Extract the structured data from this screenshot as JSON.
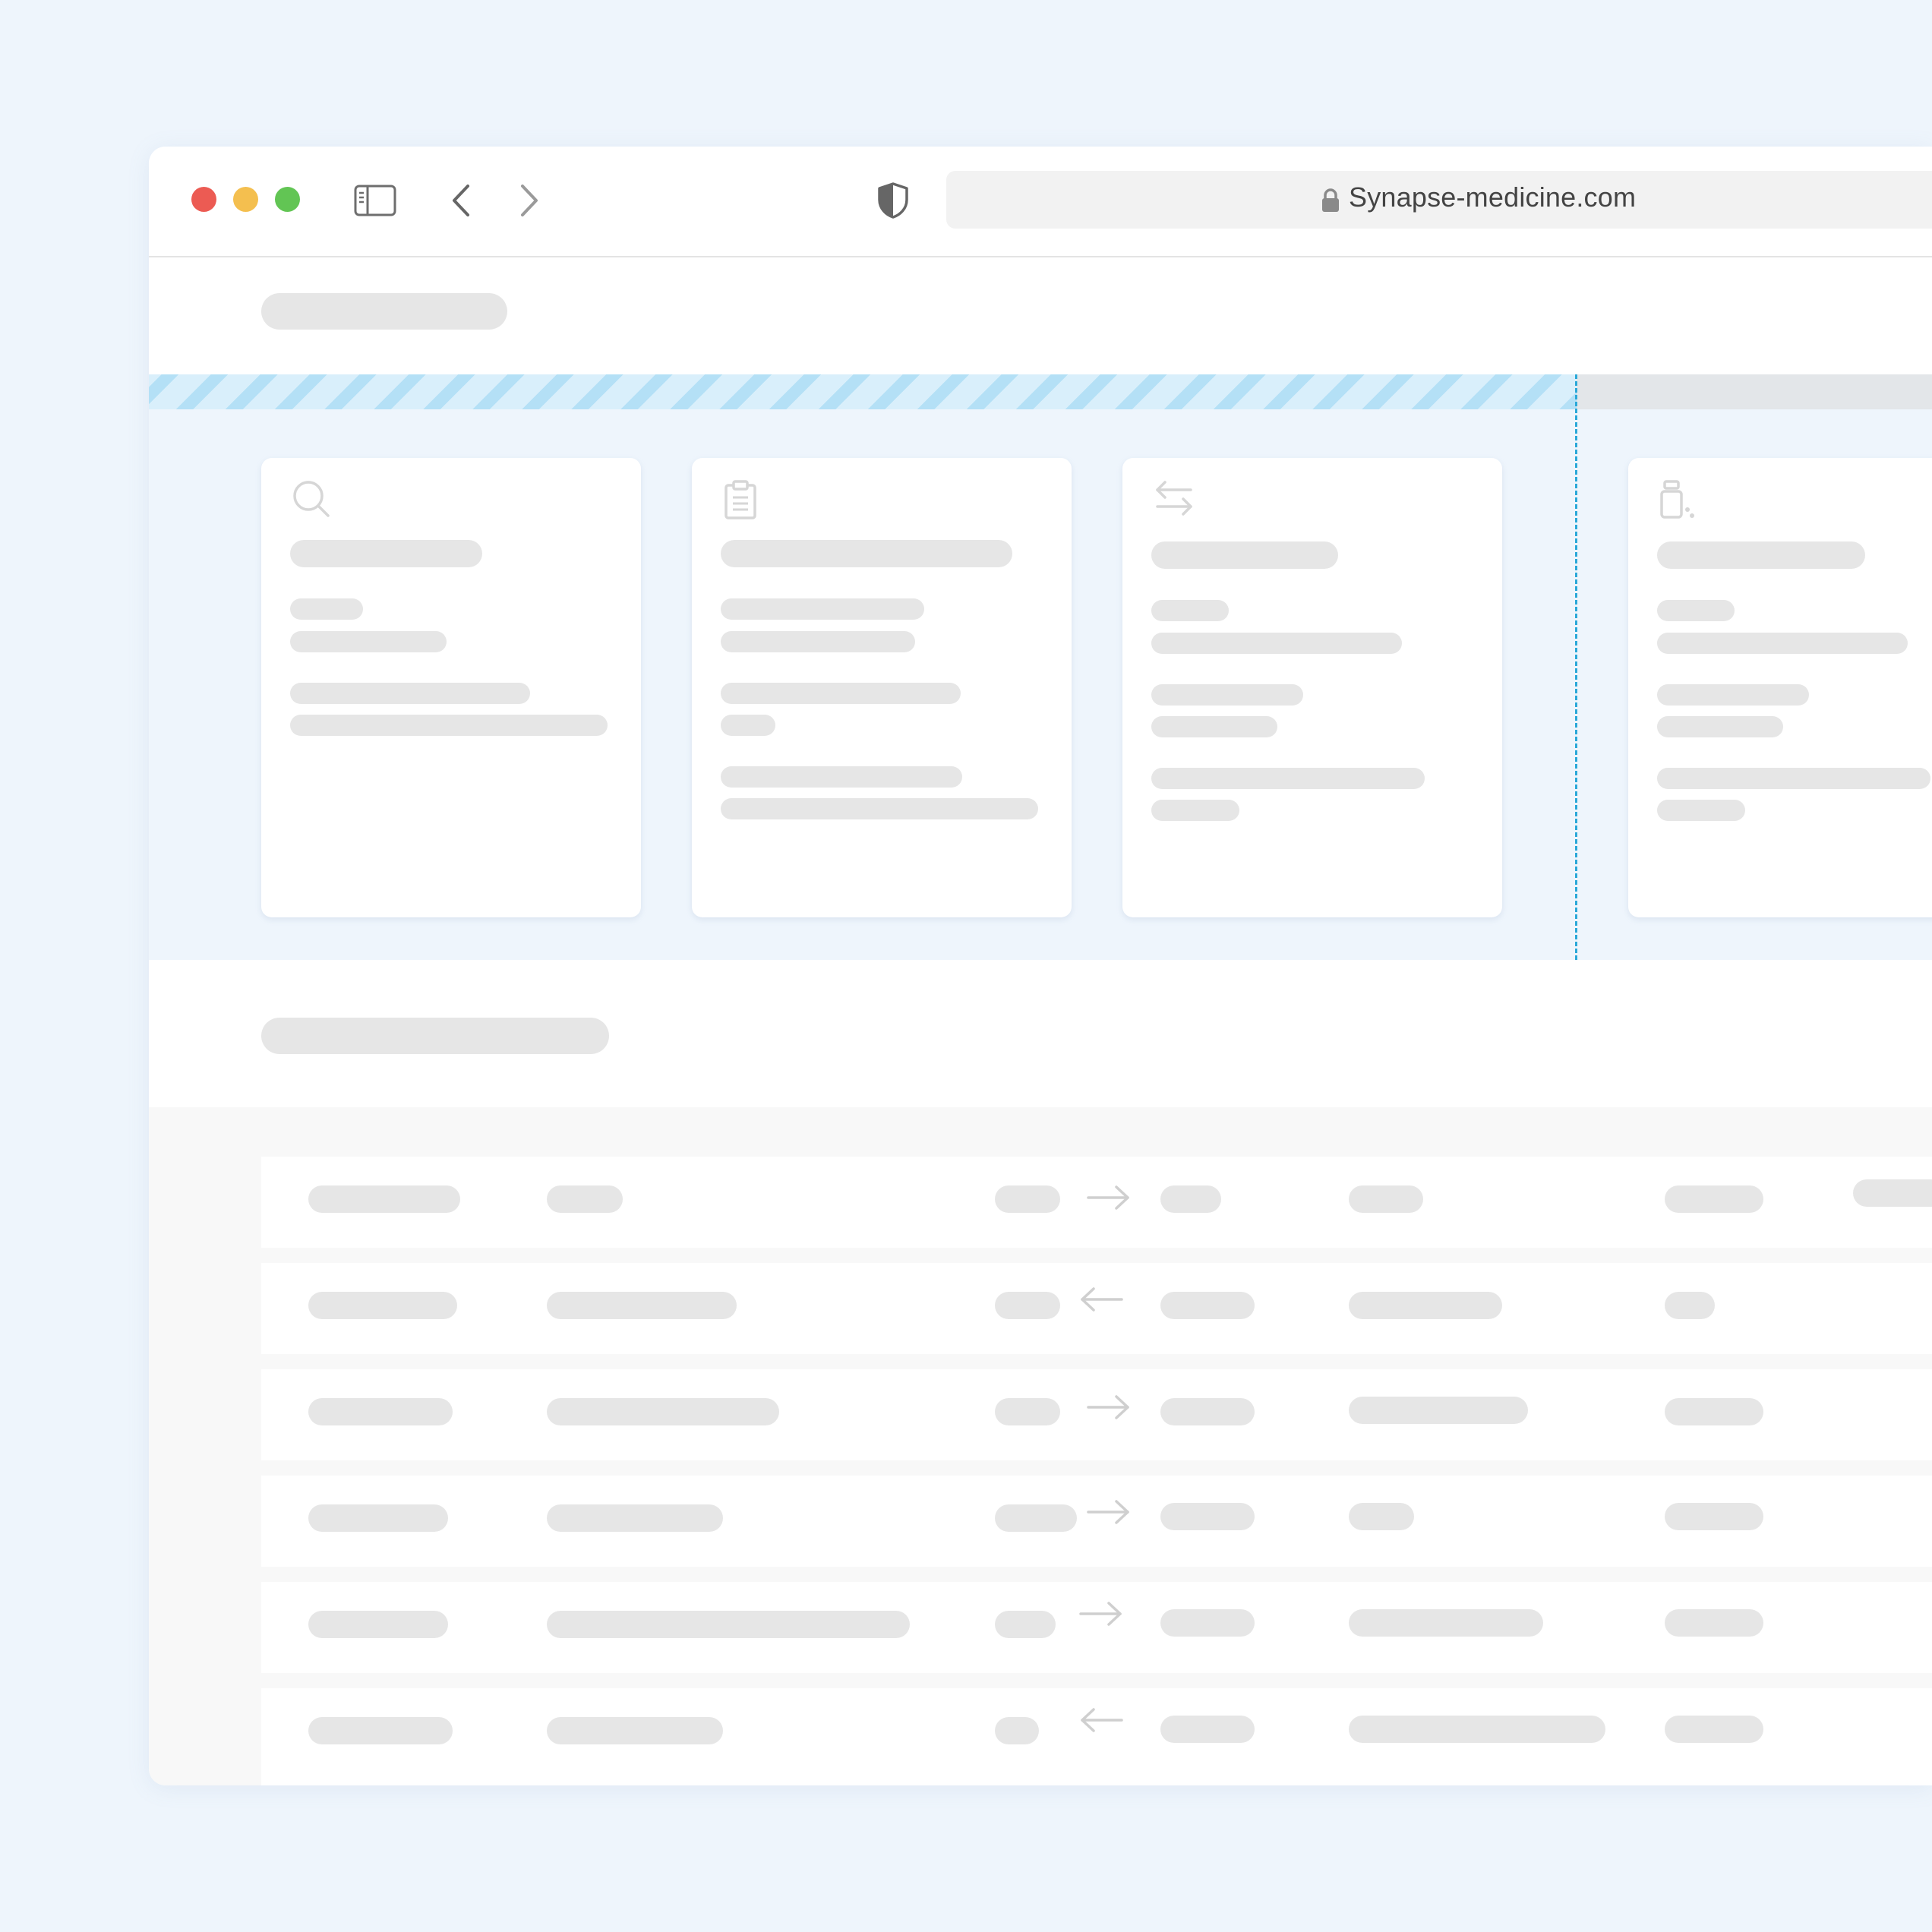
{
  "browser": {
    "url": "Synapse-medicine.com"
  },
  "colors": {
    "page_bg": "#eef5fc",
    "close": "#ec5b53",
    "minimize": "#f4bf4f",
    "maximize": "#62c554",
    "skeleton": "#e6e6e6",
    "progress_stripe": "#b4e0f6",
    "progress_marker": "#2aa8d8"
  },
  "icons": {
    "titlebar": [
      "sidebar-toggle-icon",
      "back-chevron-icon",
      "forward-chevron-icon",
      "shield-icon",
      "lock-icon"
    ],
    "cards": [
      "search-icon",
      "clipboard-icon",
      "swap-arrows-icon",
      "medicine-bottle-icon"
    ],
    "row_arrows": [
      "arrow-right",
      "arrow-left",
      "arrow-right",
      "arrow-right",
      "arrow-right",
      "arrow-left"
    ]
  },
  "progress": {
    "filled_fraction": 0.8
  }
}
